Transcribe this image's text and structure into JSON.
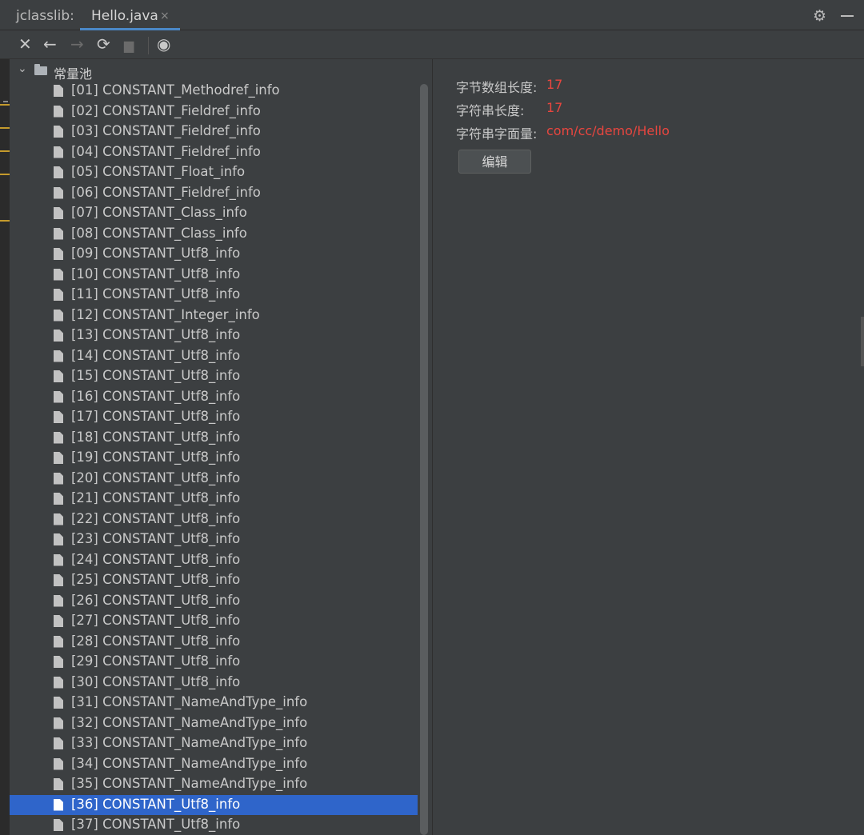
{
  "window": {
    "app_title": "jclasslib:",
    "tab_label": "Hello.java",
    "tab_close": "×"
  },
  "toolbar": {
    "icons": [
      "close-icon",
      "back-arrow-icon",
      "forward-arrow-icon",
      "refresh-icon",
      "save-icon",
      "web-icon"
    ],
    "close": "✕",
    "back": "←",
    "forward": "→",
    "refresh": "⟳",
    "save": "▆",
    "web": "◉"
  },
  "tree": {
    "root_label": "常量池",
    "selected_index": 35,
    "items": [
      "[01] CONSTANT_Methodref_info",
      "[02] CONSTANT_Fieldref_info",
      "[03] CONSTANT_Fieldref_info",
      "[04] CONSTANT_Fieldref_info",
      "[05] CONSTANT_Float_info",
      "[06] CONSTANT_Fieldref_info",
      "[07] CONSTANT_Class_info",
      "[08] CONSTANT_Class_info",
      "[09] CONSTANT_Utf8_info",
      "[10] CONSTANT_Utf8_info",
      "[11] CONSTANT_Utf8_info",
      "[12] CONSTANT_Integer_info",
      "[13] CONSTANT_Utf8_info",
      "[14] CONSTANT_Utf8_info",
      "[15] CONSTANT_Utf8_info",
      "[16] CONSTANT_Utf8_info",
      "[17] CONSTANT_Utf8_info",
      "[18] CONSTANT_Utf8_info",
      "[19] CONSTANT_Utf8_info",
      "[20] CONSTANT_Utf8_info",
      "[21] CONSTANT_Utf8_info",
      "[22] CONSTANT_Utf8_info",
      "[23] CONSTANT_Utf8_info",
      "[24] CONSTANT_Utf8_info",
      "[25] CONSTANT_Utf8_info",
      "[26] CONSTANT_Utf8_info",
      "[27] CONSTANT_Utf8_info",
      "[28] CONSTANT_Utf8_info",
      "[29] CONSTANT_Utf8_info",
      "[30] CONSTANT_Utf8_info",
      "[31] CONSTANT_NameAndType_info",
      "[32] CONSTANT_NameAndType_info",
      "[33] CONSTANT_NameAndType_info",
      "[34] CONSTANT_NameAndType_info",
      "[35] CONSTANT_NameAndType_info",
      "[36] CONSTANT_Utf8_info",
      "[37] CONSTANT_Utf8_info"
    ]
  },
  "detail": {
    "byte_length_label": "字节数组长度:",
    "byte_length_value": "17",
    "string_length_label": "字符串长度:",
    "string_length_value": "17",
    "string_literal_label": "字符串字面量:",
    "string_literal_value": "com/cc/demo/Hello",
    "edit_button": "编辑"
  },
  "colors": {
    "background": "#3c3f41",
    "selection": "#2f65ca",
    "value_red": "#e8463f",
    "tab_underline": "#4a88c7"
  }
}
